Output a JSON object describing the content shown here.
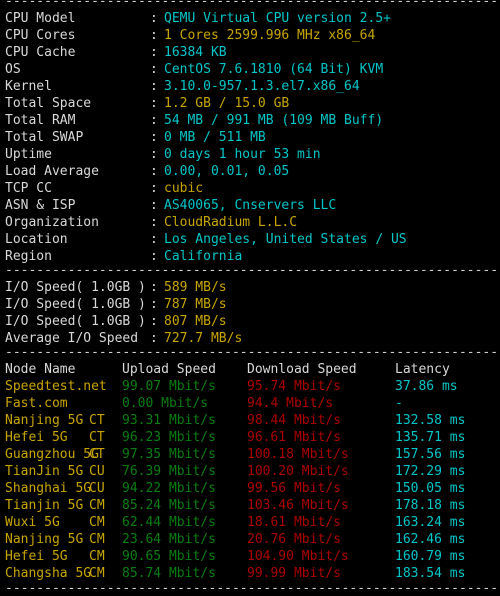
{
  "terminal": {
    "separator_top": "----------------------------------------------------------------------",
    "separator_mid": "----------------------------------------------------------------------",
    "separator_tbl": "----------------------------------------------------------------------",
    "separator_bottom": "----------------------------------------------------------------------",
    "colon": ":"
  },
  "colors": {
    "background": "#000000",
    "label": "#d8d8d8",
    "cyan": "#00c5c7",
    "yellow": "#c7a500",
    "green_upload": "#0a7d12",
    "red_download": "#ab0000",
    "separator": "#d0d0d0"
  },
  "system_info": [
    {
      "label": "CPU Model",
      "value": "QEMU Virtual CPU version 2.5+",
      "color": "v-cyan"
    },
    {
      "label": "CPU Cores",
      "value": "1 Cores 2599.996 MHz x86_64",
      "color": "v-yellow"
    },
    {
      "label": "CPU Cache",
      "value": "16384 KB",
      "color": "v-cyan"
    },
    {
      "label": "OS",
      "value": "CentOS 7.6.1810 (64 Bit) KVM",
      "color": "v-cyan"
    },
    {
      "label": "Kernel",
      "value": "3.10.0-957.1.3.el7.x86_64",
      "color": "v-cyan"
    },
    {
      "label": "Total Space",
      "value": "1.2 GB / 15.0 GB",
      "color": "v-yellow"
    },
    {
      "label": "Total RAM",
      "value": "54 MB / 991 MB (109 MB Buff)",
      "color": "v-cyan"
    },
    {
      "label": "Total SWAP",
      "value": "0 MB / 511 MB",
      "color": "v-cyan"
    },
    {
      "label": "Uptime",
      "value": "0 days 1 hour 53 min",
      "color": "v-cyan"
    },
    {
      "label": "Load Average",
      "value": "0.00, 0.01, 0.05",
      "color": "v-cyan"
    },
    {
      "label": "TCP CC",
      "value": "cubic",
      "color": "v-yellow"
    },
    {
      "label": "ASN & ISP",
      "value": "AS40065, Cnservers LLC",
      "color": "v-cyan"
    },
    {
      "label": "Organization",
      "value": "CloudRadium L.L.C",
      "color": "v-yellow"
    },
    {
      "label": "Location",
      "value": "Los Angeles, United States / US",
      "color": "v-cyan"
    },
    {
      "label": "Region",
      "value": "California",
      "color": "v-cyan"
    }
  ],
  "io_info": [
    {
      "label": "I/O Speed( 1.0GB )",
      "value": "589 MB/s",
      "color": "v-yellow"
    },
    {
      "label": "I/O Speed( 1.0GB )",
      "value": "787 MB/s",
      "color": "v-yellow"
    },
    {
      "label": "I/O Speed( 1.0GB )",
      "value": "807 MB/s",
      "color": "v-yellow"
    },
    {
      "label": "Average I/O Speed",
      "value": "727.7 MB/s",
      "color": "v-yellow"
    }
  ],
  "speedtest": {
    "headers": {
      "node": "Node Name",
      "isp": "",
      "upload": "Upload Speed",
      "download": "Download Speed",
      "latency": "Latency"
    },
    "rows": [
      {
        "node": "Speedtest.net",
        "isp": "",
        "upload": "99.07 Mbit/s",
        "download": "95.74 Mbit/s",
        "latency": "37.86 ms"
      },
      {
        "node": "Fast.com",
        "isp": "",
        "upload": "0.00 Mbit/s",
        "download": "94.4 Mbit/s",
        "latency": "-"
      },
      {
        "node": "Nanjing 5G",
        "isp": "CT",
        "upload": "93.31 Mbit/s",
        "download": "98.44 Mbit/s",
        "latency": "132.58 ms"
      },
      {
        "node": "Hefei 5G",
        "isp": "CT",
        "upload": "96.23 Mbit/s",
        "download": "96.61 Mbit/s",
        "latency": "135.71 ms"
      },
      {
        "node": "Guangzhou 5G",
        "isp": "CT",
        "upload": "97.35 Mbit/s",
        "download": "100.18 Mbit/s",
        "latency": "157.56 ms"
      },
      {
        "node": "TianJin 5G",
        "isp": "CU",
        "upload": "76.39 Mbit/s",
        "download": "100.20 Mbit/s",
        "latency": "172.29 ms"
      },
      {
        "node": "Shanghai 5G",
        "isp": "CU",
        "upload": "94.22 Mbit/s",
        "download": "99.56 Mbit/s",
        "latency": "150.05 ms"
      },
      {
        "node": "Tianjin 5G",
        "isp": "CM",
        "upload": "85.24 Mbit/s",
        "download": "103.46 Mbit/s",
        "latency": "178.18 ms"
      },
      {
        "node": "Wuxi 5G",
        "isp": "CM",
        "upload": "62.44 Mbit/s",
        "download": "18.61 Mbit/s",
        "latency": "163.24 ms"
      },
      {
        "node": "Nanjing 5G",
        "isp": "CM",
        "upload": "23.64 Mbit/s",
        "download": "20.76 Mbit/s",
        "latency": "162.46 ms"
      },
      {
        "node": "Hefei 5G",
        "isp": "CM",
        "upload": "90.65 Mbit/s",
        "download": "104.90 Mbit/s",
        "latency": "160.79 ms"
      },
      {
        "node": "Changsha 5G",
        "isp": "CM",
        "upload": "85.74 Mbit/s",
        "download": "99.99 Mbit/s",
        "latency": "183.54 ms"
      }
    ]
  }
}
